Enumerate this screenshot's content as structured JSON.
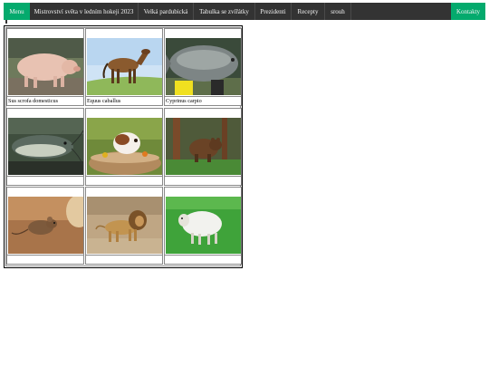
{
  "nav": {
    "items": [
      {
        "label": "Menu"
      },
      {
        "label": "Mistrovství světa v ledním hokeji 2023"
      },
      {
        "label": "Velká pardubická"
      },
      {
        "label": "Tabulka se zvířátky"
      },
      {
        "label": "Prezidenti"
      },
      {
        "label": "Recepty"
      },
      {
        "label": "srouh"
      },
      {
        "label": "Kontakty"
      }
    ],
    "accent": "#04AA6D",
    "bar_color": "#333333"
  },
  "gallery": {
    "cells": [
      {
        "animal": "pig",
        "caption": "Sus scrofa domesticus"
      },
      {
        "animal": "horse",
        "caption": "Equus caballus"
      },
      {
        "animal": "carp",
        "caption": "Cyprinus carpio"
      },
      {
        "animal": "catfish",
        "caption": ""
      },
      {
        "animal": "guinea-pig",
        "caption": ""
      },
      {
        "animal": "bear",
        "caption": ""
      },
      {
        "animal": "mouse",
        "caption": ""
      },
      {
        "animal": "lion",
        "caption": ""
      },
      {
        "animal": "sheep",
        "caption": ""
      }
    ]
  }
}
